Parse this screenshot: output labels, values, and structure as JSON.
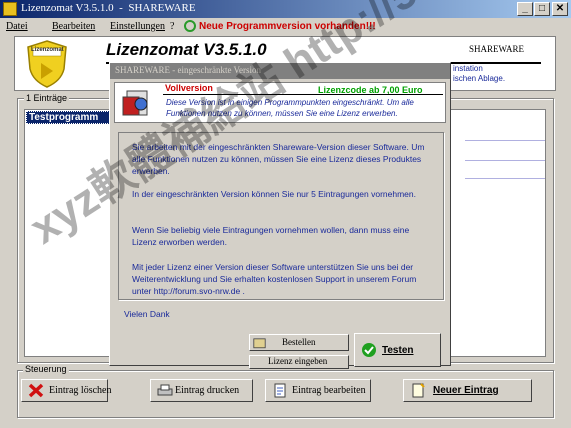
{
  "window": {
    "title": "Lizenzomat V3.5.1.0  -  SHAREWARE",
    "controls": [
      "_",
      "□",
      "✕"
    ]
  },
  "menu": {
    "items": [
      "Datei",
      "Bearbeiten",
      "Einstellungen",
      "?"
    ],
    "update_notice": "Neue Programmversion vorhanden!!!"
  },
  "header": {
    "logo_text": "Lizenzomat",
    "app_title": "Lizenzomat V3.5.1.0",
    "edition": "SHAREWARE",
    "right_line1": "instation",
    "right_line2": "ischen Ablage."
  },
  "entries_group": {
    "label": "1 Einträge",
    "items": [
      "Testprogramm"
    ]
  },
  "dialog": {
    "title": "SHAREWARE - eingeschränkte Version",
    "headline": "Vollversion",
    "license_code": "Lizenzcode ab 7,00 Euro",
    "subtitle": "Diese Version ist in einigen Programmpunkten eingeschränkt. Um alle Funktionen nutzen zu können, müssen Sie eine Lizenz erwerben.",
    "paragraphs": [
      "Sie arbeiten mit der eingeschränkten Shareware-Version dieser Software. Um alle Funktionen nutzen zu können, müssen Sie eine Lizenz dieses Produktes erwerben.",
      "In der eingeschränkten Version können Sie nur 5 Eintragungen vornehmen.",
      "Wenn Sie beliebig viele Eintragungen vornehmen wollen, dann muss eine Lizenz erworben werden.",
      "Mit jeder Lizenz einer Version dieser Software unterstützen Sie uns bei der Weiterentwicklung und Sie erhalten kostenlosen Support in unserem Forum unter http://forum.svo-nrw.de ."
    ],
    "signature": "Vielen Dank",
    "buttons": {
      "order": "Bestellen",
      "enter_license": "Lizenz eingeben",
      "test": "Testen"
    }
  },
  "controls_group": {
    "label": "Steuerung",
    "buttons": [
      "Eintrag löschen",
      "Eintrag drucken",
      "Eintrag bearbeiten",
      "Neuer Eintrag"
    ]
  },
  "watermark": "xyz軟體補給站 http://51.to",
  "colors": {
    "titlebar_start": "#0a246a",
    "titlebar_end": "#a6caf0",
    "update_red": "#cc0000",
    "license_green": "#00a000",
    "dialog_text_blue": "#1a2a9a"
  }
}
